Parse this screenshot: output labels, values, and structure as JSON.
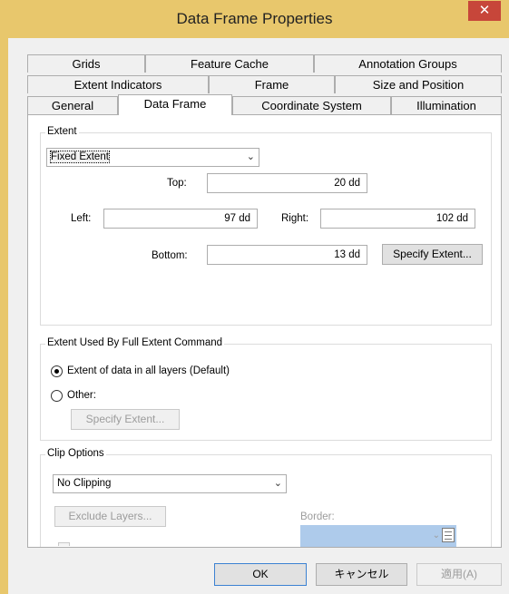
{
  "dialog": {
    "title": "Data Frame Properties",
    "close_glyph": "✕"
  },
  "tabs": {
    "row1": [
      "Grids",
      "Feature Cache",
      "Annotation Groups"
    ],
    "row2": [
      "Extent Indicators",
      "Frame",
      "Size and Position"
    ],
    "row3": [
      "General",
      "Data Frame",
      "Coordinate System",
      "Illumination"
    ],
    "active": "Data Frame"
  },
  "extent": {
    "group_title": "Extent",
    "mode_value": "Fixed Extent",
    "top_label": "Top:",
    "top_value": "20 dd",
    "left_label": "Left:",
    "left_value": "97 dd",
    "right_label": "Right:",
    "right_value": "102 dd",
    "bottom_label": "Bottom:",
    "bottom_value": "13 dd",
    "specify_button": "Specify Extent..."
  },
  "full_extent": {
    "group_title": "Extent Used By Full Extent Command",
    "option_default": "Extent of data in all layers (Default)",
    "option_other": "Other:",
    "specify_button": "Specify Extent...",
    "selected": "default"
  },
  "clip": {
    "group_title": "Clip Options",
    "mode_value": "No Clipping",
    "exclude_button": "Exclude Layers...",
    "border_label": "Border:"
  },
  "footer": {
    "ok": "OK",
    "cancel": "キャンセル",
    "apply": "適用(A)"
  },
  "colors": {
    "title_bar": "#e8c76c",
    "close_button": "#c7463a",
    "border_swatch": "#aecbeb"
  }
}
